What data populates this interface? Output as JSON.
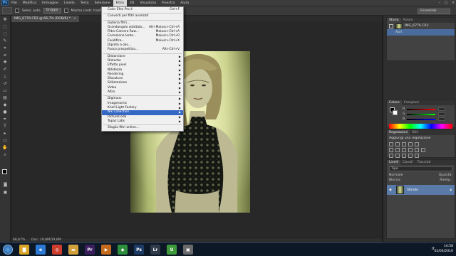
{
  "app": {
    "logo": "Ps",
    "window_controls": [
      "–",
      "□",
      "✕"
    ]
  },
  "menubar": {
    "items": [
      "File",
      "Modifica",
      "Immagine",
      "Livello",
      "Testo",
      "Selezione",
      "Filtro",
      "3D",
      "Visualizza",
      "Finestra",
      "Aiuto"
    ],
    "active": "Filtro"
  },
  "options_bar": {
    "sample_label": "Selez. auto",
    "sample_value": "Gruppo",
    "show_transform": "Mostra contr. trasformaz.",
    "workspace": "Essenziali"
  },
  "document": {
    "tab_label": "IMG_6776.CR2 @ 66,7% (RGB/8) *",
    "close": "×",
    "zoom": "66,67%",
    "doc_info": "Doc: 19,8M/19,8M"
  },
  "filter_menu": {
    "items": [
      {
        "label": "Color Efex Pro 4",
        "shortcut": "Ctrl+F"
      },
      {
        "sep": true
      },
      {
        "label": "Converti per filtri avanzati"
      },
      {
        "sep": true
      },
      {
        "label": "Galleria filtri..."
      },
      {
        "label": "Grandangolo adattato...",
        "shortcut": "Alt+Maiusc+Ctrl+A"
      },
      {
        "label": "Filtro Camera Raw...",
        "shortcut": "Maiusc+Ctrl+A"
      },
      {
        "label": "Correzione lente...",
        "shortcut": "Maiusc+Ctrl+R"
      },
      {
        "label": "Fluidifica...",
        "shortcut": "Maiusc+Ctrl+X"
      },
      {
        "label": "Dipinto a olio..."
      },
      {
        "label": "Fuoco prospettico...",
        "shortcut": "Alt+Ctrl+V"
      },
      {
        "sep": true
      },
      {
        "label": "Distorsione",
        "submenu": true
      },
      {
        "label": "Disturbo",
        "submenu": true
      },
      {
        "label": "Effetto pixel",
        "submenu": true
      },
      {
        "label": "Nitidezza",
        "submenu": true
      },
      {
        "label": "Rendering",
        "submenu": true
      },
      {
        "label": "Sfocatura",
        "submenu": true
      },
      {
        "label": "Stilizzazione",
        "submenu": true
      },
      {
        "label": "Video",
        "submenu": true
      },
      {
        "label": "Altro",
        "submenu": true
      },
      {
        "sep": true
      },
      {
        "label": "Digimarc",
        "submenu": true
      },
      {
        "label": "Imagenomic",
        "submenu": true
      },
      {
        "label": "Knoll Light Factory",
        "submenu": true
      },
      {
        "label": "Nik Collection",
        "submenu": true,
        "highlighted": true
      },
      {
        "label": "PictureCode",
        "submenu": true
      },
      {
        "label": "Topaz Labs",
        "submenu": true
      },
      {
        "sep": true
      },
      {
        "label": "Sfoglia filtri online..."
      }
    ]
  },
  "history_panel": {
    "tabs": [
      "Storia",
      "Azioni"
    ],
    "snapshot": "IMG_6776.CR2",
    "steps": [
      "Apri"
    ]
  },
  "color_panel": {
    "tabs": [
      "Colore",
      "Campioni"
    ],
    "channels": [
      "R",
      "G",
      "B"
    ]
  },
  "adjustments_panel": {
    "tabs": [
      "Regolazioni",
      "Stili"
    ],
    "title": "Aggiungi una regolazione"
  },
  "layers_panel": {
    "tabs": [
      "Livelli",
      "Canali",
      "Tracciati"
    ],
    "filter": "Tipo",
    "blend_mode": "Normale",
    "opacity_label": "Opacità:",
    "lock_label": "Blocca:",
    "fill_label": "Riemp.:",
    "layer_name": "Sfondo"
  },
  "taskbar": {
    "apps": [
      {
        "name": "explorer",
        "glyph": "▇",
        "color": "#d9a528"
      },
      {
        "name": "ie",
        "glyph": "e",
        "color": "#2b79d4"
      },
      {
        "name": "chrome",
        "glyph": "◎",
        "color": "#cc3d2e"
      },
      {
        "name": "folder",
        "glyph": "▬",
        "color": "#d1a03a"
      },
      {
        "name": "premiere",
        "glyph": "Pr",
        "color": "#3b1e5e"
      },
      {
        "name": "media",
        "glyph": "▶",
        "color": "#c36a1e"
      },
      {
        "name": "app",
        "glyph": "◆",
        "color": "#2e8f3e"
      },
      {
        "name": "photoshop",
        "glyph": "Ps",
        "color": "#1c3b64"
      },
      {
        "name": "lightroom",
        "glyph": "Lr",
        "color": "#2f3a4a"
      },
      {
        "name": "upwork",
        "glyph": "U",
        "color": "#3f9a3c"
      },
      {
        "name": "app2",
        "glyph": "▣",
        "color": "#6a6a6a"
      }
    ],
    "lang": "IT",
    "time": "14:58",
    "date": "02/04/2016"
  }
}
